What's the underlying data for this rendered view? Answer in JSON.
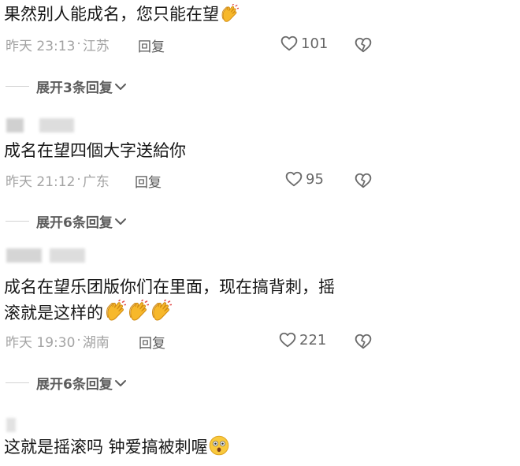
{
  "comments": [
    {
      "username": "",
      "text": "果然别人能成名，您只能在望",
      "text_line2": "",
      "emoji": "clap-emoji",
      "emoji_count": 1,
      "time": "昨天 23:13",
      "location": "江苏",
      "reply_label": "回复",
      "likes": "101",
      "expand_label": "展开3条回复"
    },
    {
      "username": "",
      "text": "成名在望四個大字送給你",
      "text_line2": "",
      "emoji": "",
      "emoji_count": 0,
      "time": "昨天 21:12",
      "location": "广东",
      "reply_label": "回复",
      "likes": "95",
      "expand_label": "展开6条回复"
    },
    {
      "username": "",
      "text": "成名在望乐团版你们在里面，现在搞背刺，摇",
      "text_line2": "滚就是这样的",
      "emoji": "clap-emoji",
      "emoji_count": 3,
      "time": "昨天 19:30",
      "location": "湖南",
      "reply_label": "回复",
      "likes": "221",
      "expand_label": "展开6条回复"
    },
    {
      "username": "",
      "text": "这就是摇滚吗 钟爱搞被刺喔",
      "text_line2": "",
      "emoji": "astonished-emoji",
      "emoji_count": 1
    }
  ],
  "meta_separator": "·",
  "colors": {
    "text": "#161616",
    "meta": "#a3a3a3",
    "expand": "#5c5c5c",
    "divider": "#d3d3d3"
  }
}
